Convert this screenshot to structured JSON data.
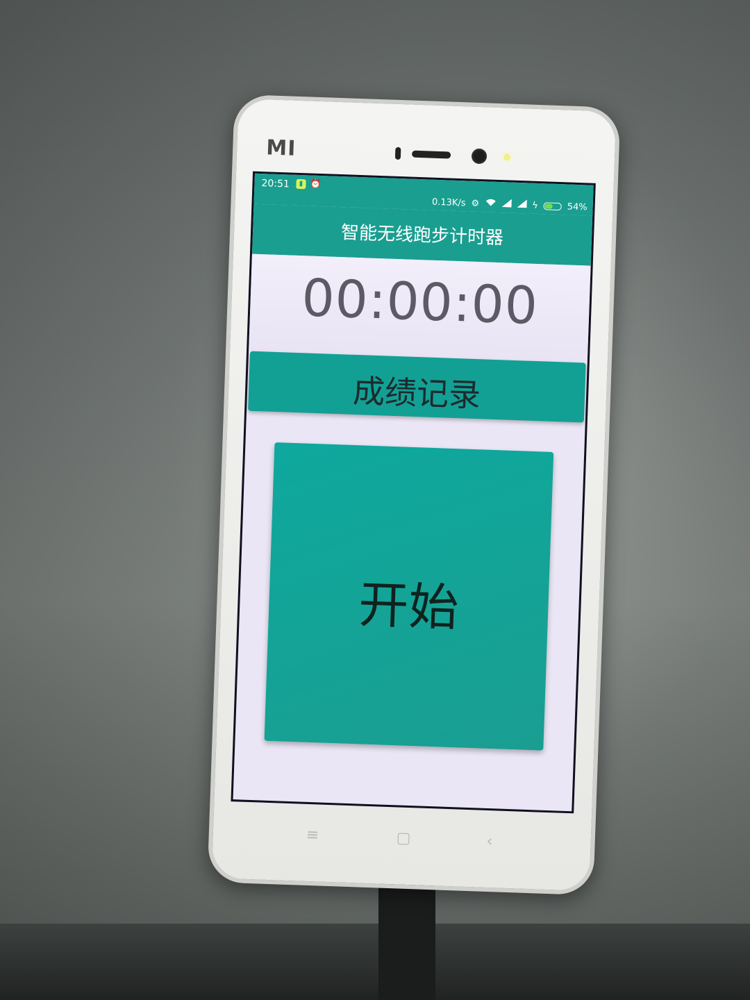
{
  "status_bar": {
    "time": "20:51",
    "net_speed": "0.13K/s",
    "battery_percent_label": "54%",
    "battery_level": 0.54,
    "icons": [
      "battery-saver-icon",
      "alarm-icon",
      "settings-icon",
      "wifi-icon",
      "signal-icon",
      "signal-icon",
      "charging-icon"
    ]
  },
  "app": {
    "title": "智能无线跑步计时器"
  },
  "timer": {
    "value": "00:00:00"
  },
  "buttons": {
    "records_label": "成绩记录",
    "start_label": "开始"
  },
  "device": {
    "brand_mark": "MI"
  },
  "colors": {
    "primary": "#1a9e90",
    "background": "#ebe6f5",
    "button": "#12a094",
    "timer_text": "#5d5a66"
  }
}
